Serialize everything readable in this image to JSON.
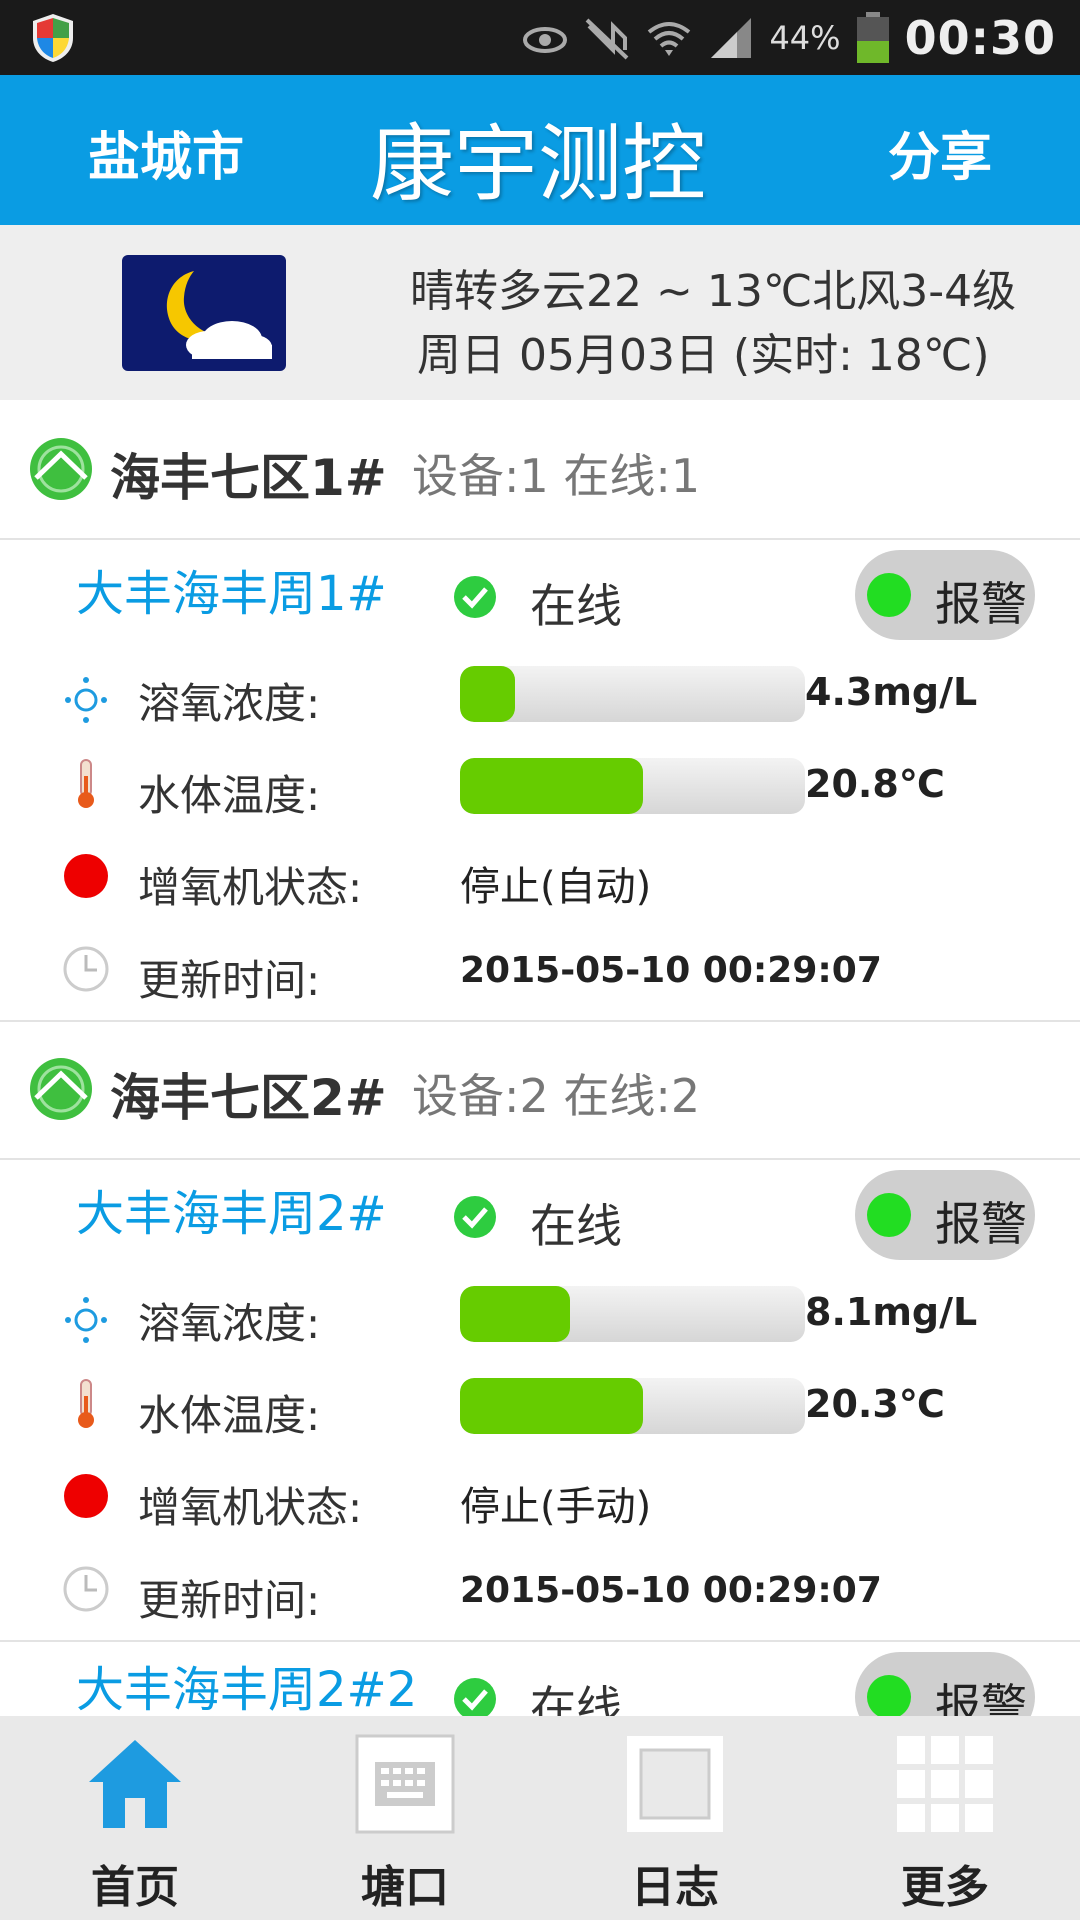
{
  "status_bar": {
    "battery": "44%",
    "time": "00:30"
  },
  "header": {
    "city": "盐城市",
    "title": "康宇测控",
    "share": "分享"
  },
  "weather": {
    "icon": "moon-cloud-icon",
    "line1": "晴转多云22 ~ 13℃北风3-4级",
    "line2": "周日 05月03日 (实时: 18℃)"
  },
  "groups": [
    {
      "name": "海丰七区1#",
      "stats": "设备:1  在线:1"
    },
    {
      "name": "海丰七区2#",
      "stats": "设备:2  在线:2"
    }
  ],
  "devices": [
    {
      "name": "大丰海丰周1#",
      "online": "在线",
      "alarm": "报警",
      "do_label": "溶氧浓度:",
      "do_value": "4.3mg/L",
      "do_fill": 0.16,
      "temp_label": "水体温度:",
      "temp_value": "20.8℃",
      "temp_fill": 0.53,
      "aerator_label": "增氧机状态:",
      "aerator_value": "停止(自动)",
      "time_label": "更新时间:",
      "time_value": "2015-05-10 00:29:07"
    },
    {
      "name": "大丰海丰周2#",
      "online": "在线",
      "alarm": "报警",
      "do_label": "溶氧浓度:",
      "do_value": "8.1mg/L",
      "do_fill": 0.32,
      "temp_label": "水体温度:",
      "temp_value": "20.3℃",
      "temp_fill": 0.53,
      "aerator_label": "增氧机状态:",
      "aerator_value": "停止(手动)",
      "time_label": "更新时间:",
      "time_value": "2015-05-10 00:29:07"
    },
    {
      "name": "大丰海丰周2#2",
      "online": "在线",
      "alarm": "报警"
    }
  ],
  "nav": [
    {
      "label": "首页",
      "icon": "home-icon"
    },
    {
      "label": "塘口",
      "icon": "keyboard-icon"
    },
    {
      "label": "日志",
      "icon": "log-icon"
    },
    {
      "label": "更多",
      "icon": "grid-icon"
    }
  ],
  "colors": {
    "accent": "#0a9ce3",
    "bar_fill": "#66cc00",
    "alarm_dot": "#22dd22",
    "aerator_stop": "#ee0000"
  }
}
